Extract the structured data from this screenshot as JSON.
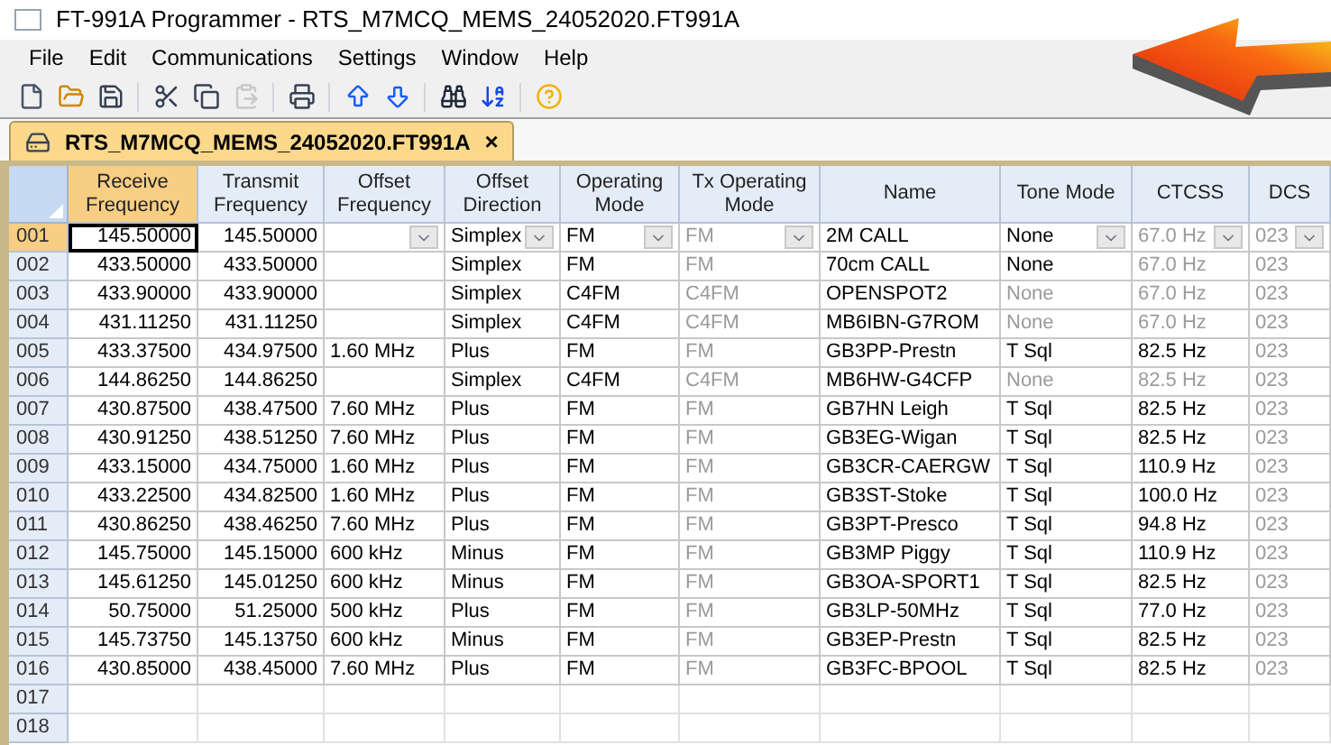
{
  "window": {
    "title": "FT-991A Programmer - RTS_M7MCQ_MEMS_24052020.FT991A"
  },
  "menu": [
    "File",
    "Edit",
    "Communications",
    "Settings",
    "Window",
    "Help"
  ],
  "toolbar": [
    [
      {
        "kind": "new",
        "disabled": false
      },
      {
        "kind": "open",
        "disabled": false
      },
      {
        "kind": "save",
        "disabled": false
      }
    ],
    [
      {
        "kind": "cut",
        "disabled": false
      },
      {
        "kind": "copy",
        "disabled": false
      },
      {
        "kind": "paste",
        "disabled": true
      }
    ],
    [
      {
        "kind": "print",
        "disabled": false
      }
    ],
    [
      {
        "kind": "up",
        "disabled": false
      },
      {
        "kind": "down",
        "disabled": false
      }
    ],
    [
      {
        "kind": "find",
        "disabled": false
      },
      {
        "kind": "sort",
        "disabled": false
      }
    ],
    [
      {
        "kind": "help",
        "disabled": false
      }
    ]
  ],
  "tabs": [
    {
      "label": "RTS_M7MCQ_MEMS_24052020.FT991A",
      "close": "×",
      "selected": true
    }
  ],
  "table": {
    "columns": [
      {
        "label": "Receive Frequency",
        "kind": "number",
        "selected": true
      },
      {
        "label": "Transmit Frequency",
        "kind": "number",
        "selected": false
      },
      {
        "label": "Offset Frequency",
        "kind": "dropdown",
        "selected": false
      },
      {
        "label": "Offset Direction",
        "kind": "dropdown",
        "selected": false
      },
      {
        "label": "Operating Mode",
        "kind": "dropdown",
        "selected": false
      },
      {
        "label": "Tx Operating Mode",
        "kind": "dropdown",
        "selected": false
      },
      {
        "label": "Name",
        "kind": "text",
        "selected": false
      },
      {
        "label": "Tone Mode",
        "kind": "dropdown",
        "selected": false
      },
      {
        "label": "CTCSS",
        "kind": "dropdown",
        "selected": false
      },
      {
        "label": "DCS",
        "kind": "dropdown",
        "selected": false
      }
    ],
    "rows": [
      {
        "number": "001",
        "selected": true,
        "cells": [
          {
            "text": "145.50000",
            "disabled": false
          },
          {
            "text": "145.50000",
            "disabled": false
          },
          {
            "disabled": false
          },
          {
            "text": "Simplex",
            "disabled": false
          },
          {
            "text": "FM",
            "disabled": false
          },
          {
            "text": "FM",
            "disabled": true
          },
          {
            "text": "2M CALL",
            "disabled": false
          },
          {
            "text": "None",
            "disabled": false
          },
          {
            "text": "67.0 Hz",
            "disabled": true
          },
          {
            "text": "023",
            "disabled": true
          }
        ]
      },
      {
        "number": "002",
        "selected": false,
        "cells": [
          {
            "text": "433.50000",
            "disabled": false
          },
          {
            "text": "433.50000",
            "disabled": false
          },
          {
            "disabled": false
          },
          {
            "text": "Simplex",
            "disabled": false
          },
          {
            "text": "FM",
            "disabled": false
          },
          {
            "text": "FM",
            "disabled": true
          },
          {
            "text": "70cm CALL",
            "disabled": false
          },
          {
            "text": "None",
            "disabled": false
          },
          {
            "text": "67.0 Hz",
            "disabled": true
          },
          {
            "text": "023",
            "disabled": true
          }
        ]
      },
      {
        "number": "003",
        "selected": false,
        "cells": [
          {
            "text": "433.90000",
            "disabled": false
          },
          {
            "text": "433.90000",
            "disabled": false
          },
          {
            "disabled": false
          },
          {
            "text": "Simplex",
            "disabled": false
          },
          {
            "text": "C4FM",
            "disabled": false
          },
          {
            "text": "C4FM",
            "disabled": true
          },
          {
            "text": "OPENSPOT2",
            "disabled": false
          },
          {
            "text": "None",
            "disabled": true
          },
          {
            "text": "67.0 Hz",
            "disabled": true
          },
          {
            "text": "023",
            "disabled": true
          }
        ]
      },
      {
        "number": "004",
        "selected": false,
        "cells": [
          {
            "text": "431.11250",
            "disabled": false
          },
          {
            "text": "431.11250",
            "disabled": false
          },
          {
            "disabled": false
          },
          {
            "text": "Simplex",
            "disabled": false
          },
          {
            "text": "C4FM",
            "disabled": false
          },
          {
            "text": "C4FM",
            "disabled": true
          },
          {
            "text": "MB6IBN-G7ROM",
            "disabled": false
          },
          {
            "text": "None",
            "disabled": true
          },
          {
            "text": "67.0 Hz",
            "disabled": true
          },
          {
            "text": "023",
            "disabled": true
          }
        ]
      },
      {
        "number": "005",
        "selected": false,
        "cells": [
          {
            "text": "433.37500",
            "disabled": false
          },
          {
            "text": "434.97500",
            "disabled": false
          },
          {
            "text": "1.60 MHz",
            "disabled": false
          },
          {
            "text": "Plus",
            "disabled": false
          },
          {
            "text": "FM",
            "disabled": false
          },
          {
            "text": "FM",
            "disabled": true
          },
          {
            "text": "GB3PP-Prestn",
            "disabled": false
          },
          {
            "text": "T Sql",
            "disabled": false
          },
          {
            "text": "82.5 Hz",
            "disabled": false
          },
          {
            "text": "023",
            "disabled": true
          }
        ]
      },
      {
        "number": "006",
        "selected": false,
        "cells": [
          {
            "text": "144.86250",
            "disabled": false
          },
          {
            "text": "144.86250",
            "disabled": false
          },
          {
            "disabled": false
          },
          {
            "text": "Simplex",
            "disabled": false
          },
          {
            "text": "C4FM",
            "disabled": false
          },
          {
            "text": "C4FM",
            "disabled": true
          },
          {
            "text": "MB6HW-G4CFP",
            "disabled": false
          },
          {
            "text": "None",
            "disabled": true
          },
          {
            "text": "82.5 Hz",
            "disabled": true
          },
          {
            "text": "023",
            "disabled": true
          }
        ]
      },
      {
        "number": "007",
        "selected": false,
        "cells": [
          {
            "text": "430.87500",
            "disabled": false
          },
          {
            "text": "438.47500",
            "disabled": false
          },
          {
            "text": "7.60 MHz",
            "disabled": false
          },
          {
            "text": "Plus",
            "disabled": false
          },
          {
            "text": "FM",
            "disabled": false
          },
          {
            "text": "FM",
            "disabled": true
          },
          {
            "text": "GB7HN Leigh",
            "disabled": false
          },
          {
            "text": "T Sql",
            "disabled": false
          },
          {
            "text": "82.5 Hz",
            "disabled": false
          },
          {
            "text": "023",
            "disabled": true
          }
        ]
      },
      {
        "number": "008",
        "selected": false,
        "cells": [
          {
            "text": "430.91250",
            "disabled": false
          },
          {
            "text": "438.51250",
            "disabled": false
          },
          {
            "text": "7.60 MHz",
            "disabled": false
          },
          {
            "text": "Plus",
            "disabled": false
          },
          {
            "text": "FM",
            "disabled": false
          },
          {
            "text": "FM",
            "disabled": true
          },
          {
            "text": "GB3EG-Wigan",
            "disabled": false
          },
          {
            "text": "T Sql",
            "disabled": false
          },
          {
            "text": "82.5 Hz",
            "disabled": false
          },
          {
            "text": "023",
            "disabled": true
          }
        ]
      },
      {
        "number": "009",
        "selected": false,
        "cells": [
          {
            "text": "433.15000",
            "disabled": false
          },
          {
            "text": "434.75000",
            "disabled": false
          },
          {
            "text": "1.60 MHz",
            "disabled": false
          },
          {
            "text": "Plus",
            "disabled": false
          },
          {
            "text": "FM",
            "disabled": false
          },
          {
            "text": "FM",
            "disabled": true
          },
          {
            "text": "GB3CR-CAERGW",
            "disabled": false
          },
          {
            "text": "T Sql",
            "disabled": false
          },
          {
            "text": "110.9 Hz",
            "disabled": false
          },
          {
            "text": "023",
            "disabled": true
          }
        ]
      },
      {
        "number": "010",
        "selected": false,
        "cells": [
          {
            "text": "433.22500",
            "disabled": false
          },
          {
            "text": "434.82500",
            "disabled": false
          },
          {
            "text": "1.60 MHz",
            "disabled": false
          },
          {
            "text": "Plus",
            "disabled": false
          },
          {
            "text": "FM",
            "disabled": false
          },
          {
            "text": "FM",
            "disabled": true
          },
          {
            "text": "GB3ST-Stoke",
            "disabled": false
          },
          {
            "text": "T Sql",
            "disabled": false
          },
          {
            "text": "100.0 Hz",
            "disabled": false
          },
          {
            "text": "023",
            "disabled": true
          }
        ]
      },
      {
        "number": "011",
        "selected": false,
        "cells": [
          {
            "text": "430.86250",
            "disabled": false
          },
          {
            "text": "438.46250",
            "disabled": false
          },
          {
            "text": "7.60 MHz",
            "disabled": false
          },
          {
            "text": "Plus",
            "disabled": false
          },
          {
            "text": "FM",
            "disabled": false
          },
          {
            "text": "FM",
            "disabled": true
          },
          {
            "text": "GB3PT-Presco",
            "disabled": false
          },
          {
            "text": "T Sql",
            "disabled": false
          },
          {
            "text": "94.8 Hz",
            "disabled": false
          },
          {
            "text": "023",
            "disabled": true
          }
        ]
      },
      {
        "number": "012",
        "selected": false,
        "cells": [
          {
            "text": "145.75000",
            "disabled": false
          },
          {
            "text": "145.15000",
            "disabled": false
          },
          {
            "text": "600 kHz",
            "disabled": false
          },
          {
            "text": "Minus",
            "disabled": false
          },
          {
            "text": "FM",
            "disabled": false
          },
          {
            "text": "FM",
            "disabled": true
          },
          {
            "text": "GB3MP Piggy",
            "disabled": false
          },
          {
            "text": "T Sql",
            "disabled": false
          },
          {
            "text": "110.9 Hz",
            "disabled": false
          },
          {
            "text": "023",
            "disabled": true
          }
        ]
      },
      {
        "number": "013",
        "selected": false,
        "cells": [
          {
            "text": "145.61250",
            "disabled": false
          },
          {
            "text": "145.01250",
            "disabled": false
          },
          {
            "text": "600 kHz",
            "disabled": false
          },
          {
            "text": "Minus",
            "disabled": false
          },
          {
            "text": "FM",
            "disabled": false
          },
          {
            "text": "FM",
            "disabled": true
          },
          {
            "text": "GB3OA-SPORT1",
            "disabled": false
          },
          {
            "text": "T Sql",
            "disabled": false
          },
          {
            "text": "82.5 Hz",
            "disabled": false
          },
          {
            "text": "023",
            "disabled": true
          }
        ]
      },
      {
        "number": "014",
        "selected": false,
        "cells": [
          {
            "text": "50.75000",
            "disabled": false
          },
          {
            "text": "51.25000",
            "disabled": false
          },
          {
            "text": "500 kHz",
            "disabled": false
          },
          {
            "text": "Plus",
            "disabled": false
          },
          {
            "text": "FM",
            "disabled": false
          },
          {
            "text": "FM",
            "disabled": true
          },
          {
            "text": "GB3LP-50MHz",
            "disabled": false
          },
          {
            "text": "T Sql",
            "disabled": false
          },
          {
            "text": "77.0 Hz",
            "disabled": false
          },
          {
            "text": "023",
            "disabled": true
          }
        ]
      },
      {
        "number": "015",
        "selected": false,
        "cells": [
          {
            "text": "145.73750",
            "disabled": false
          },
          {
            "text": "145.13750",
            "disabled": false
          },
          {
            "text": "600 kHz",
            "disabled": false
          },
          {
            "text": "Minus",
            "disabled": false
          },
          {
            "text": "FM",
            "disabled": false
          },
          {
            "text": "FM",
            "disabled": true
          },
          {
            "text": "GB3EP-Prestn",
            "disabled": false
          },
          {
            "text": "T Sql",
            "disabled": false
          },
          {
            "text": "82.5 Hz",
            "disabled": false
          },
          {
            "text": "023",
            "disabled": true
          }
        ]
      },
      {
        "number": "016",
        "selected": false,
        "cells": [
          {
            "text": "430.85000",
            "disabled": false
          },
          {
            "text": "438.45000",
            "disabled": false
          },
          {
            "text": "7.60 MHz",
            "disabled": false
          },
          {
            "text": "Plus",
            "disabled": false
          },
          {
            "text": "FM",
            "disabled": false
          },
          {
            "text": "FM",
            "disabled": true
          },
          {
            "text": "GB3FC-BPOOL",
            "disabled": false
          },
          {
            "text": "T Sql",
            "disabled": false
          },
          {
            "text": "82.5 Hz",
            "disabled": false
          },
          {
            "text": "023",
            "disabled": true
          }
        ]
      },
      {
        "number": "017",
        "selected": false,
        "cells": []
      },
      {
        "number": "018",
        "selected": false,
        "cells": []
      }
    ]
  }
}
